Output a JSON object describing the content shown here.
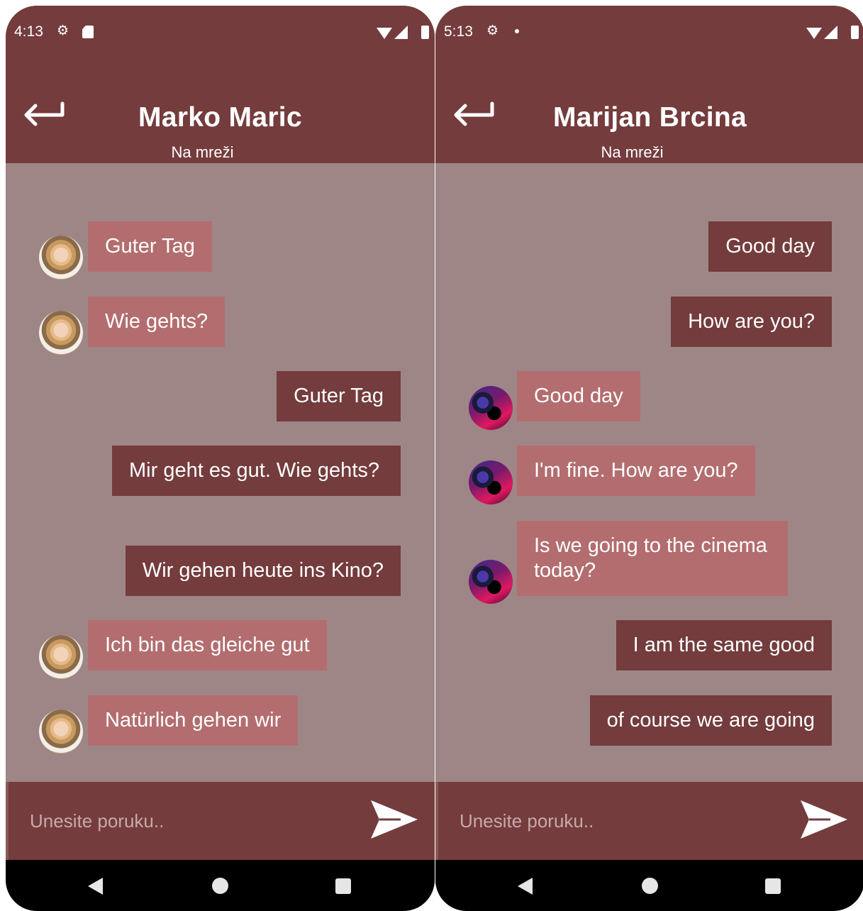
{
  "left_phone": {
    "status_bar": {
      "time": "4:13",
      "left_icons": [
        "settings-icon",
        "sd-card-icon"
      ],
      "right_icons": [
        "wifi-icon",
        "signal-icon",
        "battery-icon"
      ]
    },
    "header": {
      "title": "Marko Maric",
      "status": "Na mreži",
      "back_icon": "back-arrow-icon"
    },
    "messages": [
      {
        "text": "Guter Tag",
        "direction": "received",
        "avatar": "woman-portrait"
      },
      {
        "text": "Wie gehts?",
        "direction": "received",
        "avatar": "woman-portrait"
      },
      {
        "text": "Guter Tag",
        "direction": "sent"
      },
      {
        "text": "Mir geht es gut. Wie gehts?",
        "direction": "sent"
      },
      {
        "text": "Wir gehen heute ins Kino?",
        "direction": "sent"
      },
      {
        "text": "Ich bin das gleiche gut",
        "direction": "received",
        "avatar": "woman-portrait"
      },
      {
        "text": "Natürlich gehen wir",
        "direction": "received",
        "avatar": "woman-portrait"
      }
    ],
    "input": {
      "placeholder": "Unesite poruku..",
      "send_icon": "send-icon"
    }
  },
  "right_phone": {
    "status_bar": {
      "time": "5:13",
      "left_icons": [
        "settings-icon",
        "notification-dot"
      ],
      "right_icons": [
        "wifi-icon",
        "signal-icon",
        "battery-icon"
      ]
    },
    "header": {
      "title": "Marijan Brcina",
      "status": "Na mreži",
      "back_icon": "back-arrow-icon"
    },
    "messages": [
      {
        "text": "Good day",
        "direction": "sent"
      },
      {
        "text": "How are you?",
        "direction": "sent"
      },
      {
        "text": "Good day",
        "direction": "received",
        "avatar": "neon-portrait"
      },
      {
        "text": "I'm fine. How are you?",
        "direction": "received",
        "avatar": "neon-portrait"
      },
      {
        "text": "Is we going to the cinema today?",
        "direction": "received",
        "avatar": "neon-portrait"
      },
      {
        "text": "I am the same good",
        "direction": "sent"
      },
      {
        "text": "of course we are going",
        "direction": "sent"
      }
    ],
    "input": {
      "placeholder": "Unesite poruku..",
      "send_icon": "send-icon"
    }
  },
  "navigation_bar": [
    "nav-back-icon",
    "nav-home-icon",
    "nav-recents-icon"
  ],
  "colors": {
    "header": "#743c3d",
    "chat_background": "#9e8686",
    "sent_bubble": "#743c3d",
    "received_bubble": "#b36d6f",
    "navigation_bar": "#000000"
  }
}
